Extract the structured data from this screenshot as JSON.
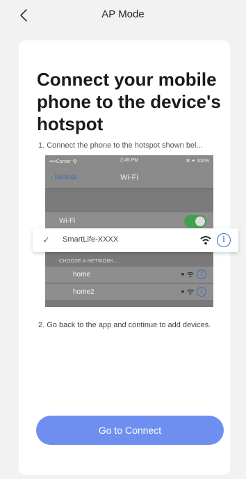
{
  "header": {
    "title": "AP Mode",
    "back_icon": "chevron-left-icon"
  },
  "card": {
    "heading": "Connect your mobile phone to the device's hotspot",
    "step1": "1. Connect the phone to the hotspot shown bel...",
    "step2": "2. Go back to the app and continue to add devices.",
    "button_label": "Go to Connect",
    "accent_color": "#6f8ff0"
  },
  "illustration": {
    "status_carrier": "••••Carrier 令",
    "status_time": "2:45 PM",
    "status_battery": "✻ ✦ 100%",
    "back_label": "‹ Settings",
    "screen_title": "Wi-Fi",
    "wifi_label": "Wi-Fi",
    "wifi_toggle_on": true,
    "selected_network": "SmartLife-XXXX",
    "choose_label": "CHOOSE A NETWORK...",
    "networks": [
      {
        "name": "home"
      },
      {
        "name": "home2"
      }
    ]
  }
}
